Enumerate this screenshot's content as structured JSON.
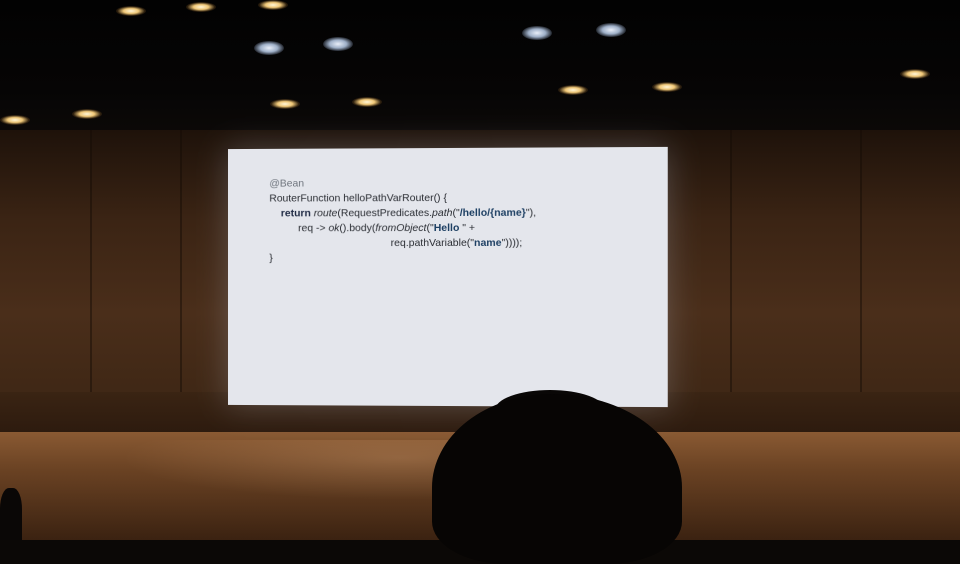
{
  "scene": {
    "description_type": "photo of presentation slide in auditorium",
    "colors": {
      "slide_background": "#e4e6ec",
      "code_text": "#2a2d33",
      "keyword": "#1f2a44",
      "string": "#1d3f63",
      "wall": "#4a2e1a",
      "floor": "#8a5a33"
    }
  },
  "slide": {
    "lines": [
      {
        "segments": [
          {
            "text": "@Bean",
            "style": "ann"
          }
        ]
      },
      {
        "segments": [
          {
            "text": "RouterFunction helloPathVarRouter() {",
            "style": "plain"
          }
        ]
      },
      {
        "segments": [
          {
            "text": "    ",
            "style": "plain"
          },
          {
            "text": "return",
            "style": "kw"
          },
          {
            "text": " ",
            "style": "plain"
          },
          {
            "text": "route",
            "style": "it"
          },
          {
            "text": "(RequestPredicates.",
            "style": "plain"
          },
          {
            "text": "path",
            "style": "it"
          },
          {
            "text": "(\"",
            "style": "plain"
          },
          {
            "text": "/hello/{name}",
            "style": "str"
          },
          {
            "text": "\"),",
            "style": "plain"
          }
        ]
      },
      {
        "segments": [
          {
            "text": "          req -> ",
            "style": "plain"
          },
          {
            "text": "ok",
            "style": "it"
          },
          {
            "text": "().body(",
            "style": "plain"
          },
          {
            "text": "fromObject",
            "style": "it"
          },
          {
            "text": "(\"",
            "style": "plain"
          },
          {
            "text": "Hello ",
            "style": "str"
          },
          {
            "text": "\" +",
            "style": "plain"
          }
        ]
      },
      {
        "segments": [
          {
            "text": "                                          req.pathVariable(\"",
            "style": "plain"
          },
          {
            "text": "name",
            "style": "str"
          },
          {
            "text": "\"))));",
            "style": "plain"
          }
        ]
      },
      {
        "segments": [
          {
            "text": "}",
            "style": "plain"
          }
        ]
      }
    ]
  }
}
